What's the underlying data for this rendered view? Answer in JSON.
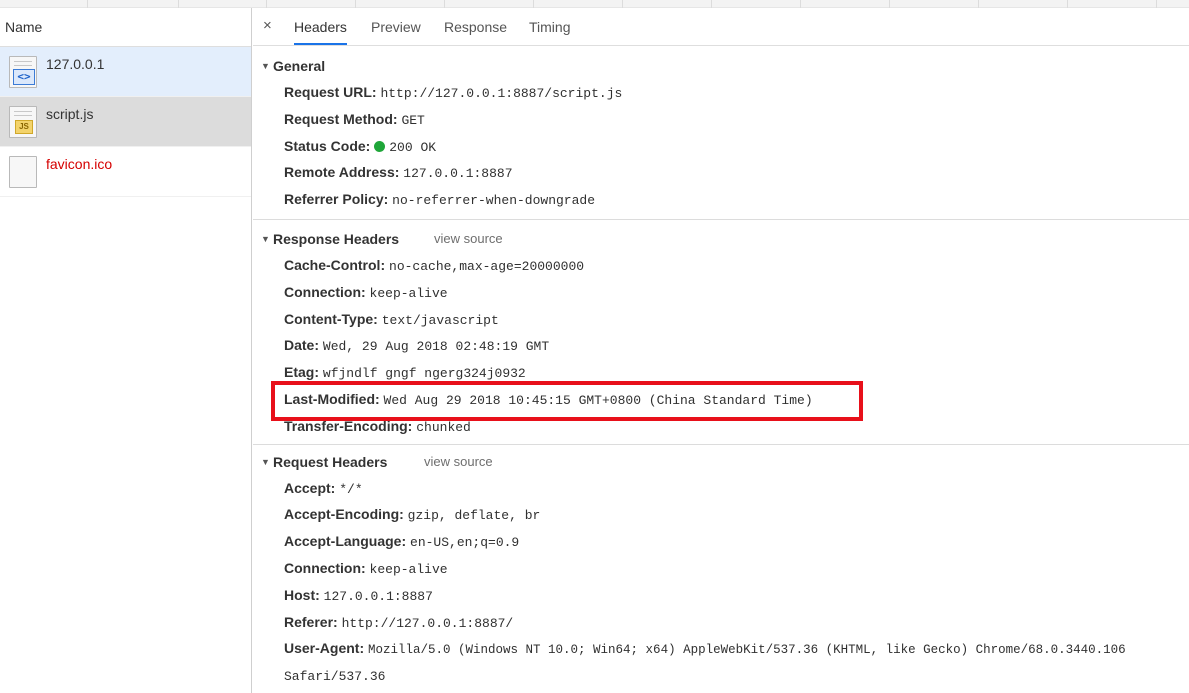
{
  "requests_panel": {
    "column_header": "Name",
    "items": [
      {
        "name": "127.0.0.1",
        "icon": "document-icon",
        "state": "selected"
      },
      {
        "name": "script.js",
        "icon": "script-icon",
        "state": "hover"
      },
      {
        "name": "favicon.ico",
        "icon": "file-icon",
        "state": "error"
      }
    ]
  },
  "tabs": {
    "close_glyph": "×",
    "items": [
      {
        "label": "Headers",
        "active": true
      },
      {
        "label": "Preview",
        "active": false
      },
      {
        "label": "Response",
        "active": false
      },
      {
        "label": "Timing",
        "active": false
      }
    ]
  },
  "general": {
    "title": "General",
    "rows": [
      {
        "k": "Request URL:",
        "v": "http://127.0.0.1:8887/script.js"
      },
      {
        "k": "Request Method:",
        "v": "GET"
      },
      {
        "k": "Status Code:",
        "v": "200 OK"
      },
      {
        "k": "Remote Address:",
        "v": "127.0.0.1:8887"
      },
      {
        "k": "Referrer Policy:",
        "v": "no-referrer-when-downgrade"
      }
    ]
  },
  "response_headers": {
    "title": "Response Headers",
    "view_source": "view source",
    "rows": [
      {
        "k": "Cache-Control:",
        "v": "no-cache,max-age=20000000"
      },
      {
        "k": "Connection:",
        "v": "keep-alive"
      },
      {
        "k": "Content-Type:",
        "v": "text/javascript"
      },
      {
        "k": "Date:",
        "v": "Wed, 29 Aug 2018 02:48:19 GMT"
      },
      {
        "k": "Etag:",
        "v": "wfjndlf gngf ngerg324j0932"
      },
      {
        "k": "Last-Modified:",
        "v": "Wed Aug 29 2018 10:45:15 GMT+0800 (China Standard Time)"
      },
      {
        "k": "Transfer-Encoding:",
        "v": "chunked"
      }
    ]
  },
  "request_headers": {
    "title": "Request Headers",
    "view_source": "view source",
    "rows": [
      {
        "k": "Accept:",
        "v": "*/*"
      },
      {
        "k": "Accept-Encoding:",
        "v": "gzip, deflate, br"
      },
      {
        "k": "Accept-Language:",
        "v": "en-US,en;q=0.9"
      },
      {
        "k": "Connection:",
        "v": "keep-alive"
      },
      {
        "k": "Host:",
        "v": "127.0.0.1:8887"
      },
      {
        "k": "Referer:",
        "v": "http://127.0.0.1:8887/"
      },
      {
        "k": "User-Agent:",
        "v": "Mozilla/5.0 (Windows NT 10.0; Win64; x64) AppleWebKit/537.36 (KHTML, like Gecko) Chrome/68.0.3440.106"
      },
      {
        "k": "",
        "v": "Safari/537.36"
      }
    ]
  },
  "colors": {
    "status_ok": "#1fa639",
    "error_text": "#d50000",
    "highlight": "#e8101a",
    "selected_row": "#e3eefc",
    "tab_underline": "#1a73e8"
  }
}
